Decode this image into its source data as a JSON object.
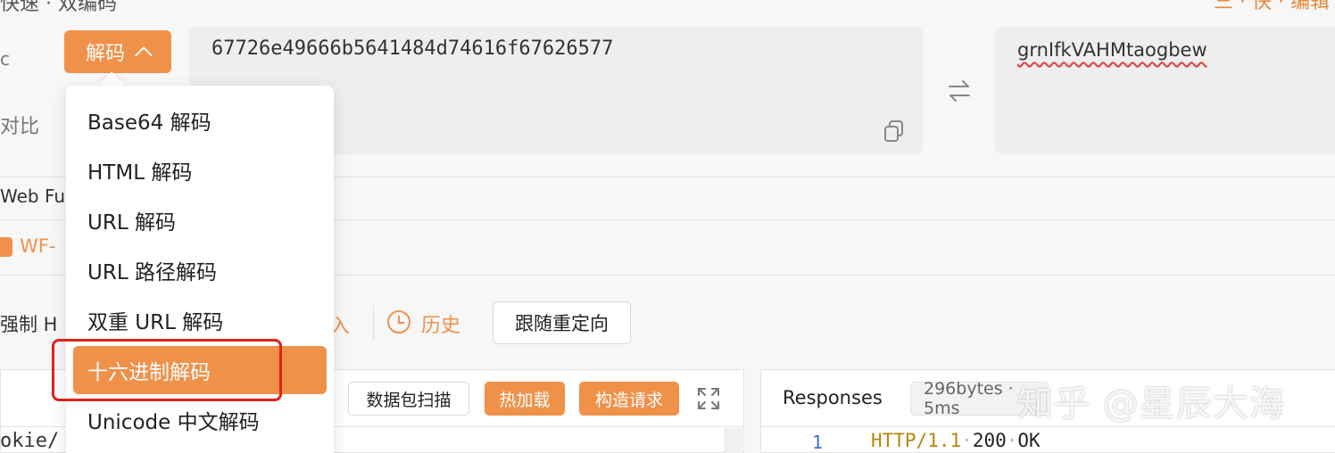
{
  "top": {
    "left_text": "快速 · 双编码",
    "right_text": "三 · 快 · 编辑"
  },
  "left_panel": {
    "label_c": "c",
    "label_compare": "对比",
    "web_fu": "Web Fu",
    "wf_text": "WF-",
    "force_http": "强制 H"
  },
  "codec": {
    "mode_button": "解码",
    "input_value": "67726e49666b5641484d74616f67626577",
    "output_value": "grnIfkVAHMtaogbew"
  },
  "dropdown": {
    "items": [
      {
        "label": "Base64 解码"
      },
      {
        "label": "HTML 解码"
      },
      {
        "label": "URL 解码"
      },
      {
        "label": "URL 路径解码"
      },
      {
        "label": "双重 URL 解码"
      },
      {
        "label": "十六进制解码"
      },
      {
        "label": "Unicode 中文解码"
      }
    ],
    "selected_index": 5
  },
  "toolbar": {
    "import_label": "入",
    "history_label": "历史",
    "redirect_label": "跟随重定向"
  },
  "request": {
    "scan_label": "数据包扫描",
    "hot_load_label": "热加载",
    "build_request_label": "构造请求",
    "code_preview": "okie/"
  },
  "response": {
    "title": "Responses",
    "bytes_badge": "296bytes · 5ms",
    "line_number": "1",
    "protocol": "HTTP/1.1",
    "status_code": "200",
    "status_text": "OK"
  },
  "watermark": "知乎 @星辰大海",
  "colors": {
    "accent": "#f0914a",
    "highlight": "#e0221a",
    "background": "#f7f7f8"
  }
}
